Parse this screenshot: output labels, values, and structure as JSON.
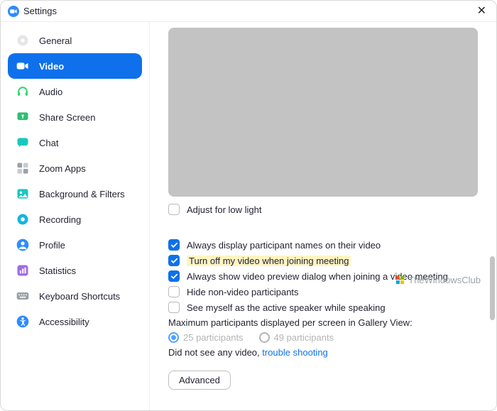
{
  "window": {
    "title": "Settings"
  },
  "sidebar": {
    "items": [
      {
        "label": "General"
      },
      {
        "label": "Video"
      },
      {
        "label": "Audio"
      },
      {
        "label": "Share Screen"
      },
      {
        "label": "Chat"
      },
      {
        "label": "Zoom Apps"
      },
      {
        "label": "Background & Filters"
      },
      {
        "label": "Recording"
      },
      {
        "label": "Profile"
      },
      {
        "label": "Statistics"
      },
      {
        "label": "Keyboard Shortcuts"
      },
      {
        "label": "Accessibility"
      }
    ]
  },
  "video": {
    "adjust_low_light": "Adjust for low light",
    "always_display_names": "Always display participant names on their video",
    "turn_off_video": "Turn off my video when joining meeting",
    "always_show_preview": "Always show video preview dialog when joining a video meeting",
    "hide_non_video": "Hide non-video participants",
    "see_myself_active": "See myself as the active speaker while speaking",
    "max_participants_label": "Maximum participants displayed per screen in Gallery View:",
    "radio_25": "25 participants",
    "radio_49": "49 participants",
    "no_video_text": "Did not see any video,",
    "troubleshoot_link": "trouble shooting",
    "advanced_btn": "Advanced"
  },
  "watermark": {
    "text": "TheWindowsClub"
  }
}
